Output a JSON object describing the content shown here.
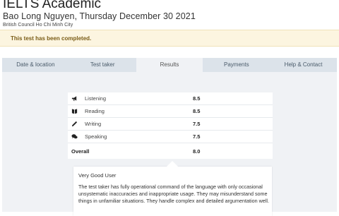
{
  "header": {
    "title": "IELTS Academic",
    "subtitle": "Bao Long Nguyen, Thursday December 30 2021",
    "centre": "British Council Ho Chi Minh City"
  },
  "status": {
    "message": "This test has been completed."
  },
  "tabs": [
    {
      "label": "Date & location",
      "active": false
    },
    {
      "label": "Test taker",
      "active": false
    },
    {
      "label": "Results",
      "active": true
    },
    {
      "label": "Payments",
      "active": false
    },
    {
      "label": "Help & Contact",
      "active": false
    }
  ],
  "results": {
    "skills": [
      {
        "icon": "megaphone-icon",
        "name": "Listening",
        "band": "8.5"
      },
      {
        "icon": "book-icon",
        "name": "Reading",
        "band": "8.5"
      },
      {
        "icon": "pencil-icon",
        "name": "Writing",
        "band": "7.5"
      },
      {
        "icon": "speech-bubbles-icon",
        "name": "Speaking",
        "band": "7.5"
      }
    ],
    "overall_label": "Overall",
    "overall_band": "8.0"
  },
  "description": {
    "title": "Very Good User",
    "body": "The test taker has fully operational command of the language with only occasional unsystematic inaccuracies and inappropriate usage. They may misunderstand some things in unfamiliar situations. They handle complex and detailed argumentation well."
  }
}
